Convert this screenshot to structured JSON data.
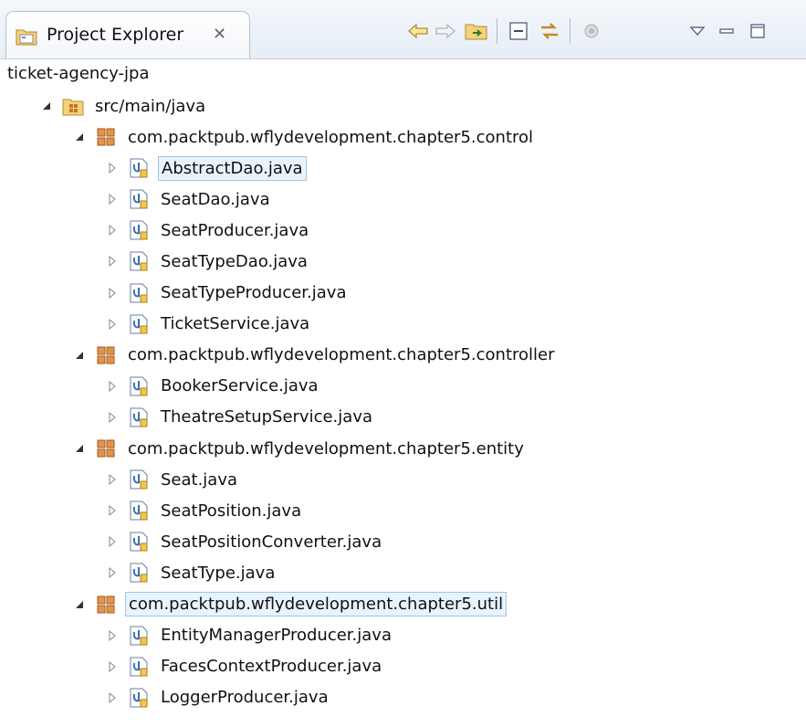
{
  "view": {
    "title": "Project Explorer",
    "close_glyph": "✕",
    "toolbar_icons": [
      "back-arrow-icon",
      "forward-arrow-icon",
      "go-into-icon",
      "collapse-all-icon",
      "link-with-editor-icon",
      "working-sets-icon",
      "view-menu-icon",
      "minimize-icon",
      "maximize-icon"
    ]
  },
  "project": {
    "name": "ticket-agency-jpa"
  },
  "source_folder": {
    "label": "src/main/java"
  },
  "packages": [
    {
      "name": "com.packtpub.wflydevelopment.chapter5.control",
      "files": [
        "AbstractDao.java",
        "SeatDao.java",
        "SeatProducer.java",
        "SeatTypeDao.java",
        "SeatTypeProducer.java",
        "TicketService.java"
      ]
    },
    {
      "name": "com.packtpub.wflydevelopment.chapter5.controller",
      "files": [
        "BookerService.java",
        "TheatreSetupService.java"
      ]
    },
    {
      "name": "com.packtpub.wflydevelopment.chapter5.entity",
      "files": [
        "Seat.java",
        "SeatPosition.java",
        "SeatPositionConverter.java",
        "SeatType.java"
      ]
    },
    {
      "name": "com.packtpub.wflydevelopment.chapter5.util",
      "files": [
        "EntityManagerProducer.java",
        "FacesContextProducer.java",
        "LoggerProducer.java"
      ]
    }
  ],
  "colors": {
    "selection_bg": "#e8f3fd",
    "selection_border": "#9fc5e8",
    "package_icon": "#c8742a",
    "java_icon": "#3b6fb0"
  }
}
